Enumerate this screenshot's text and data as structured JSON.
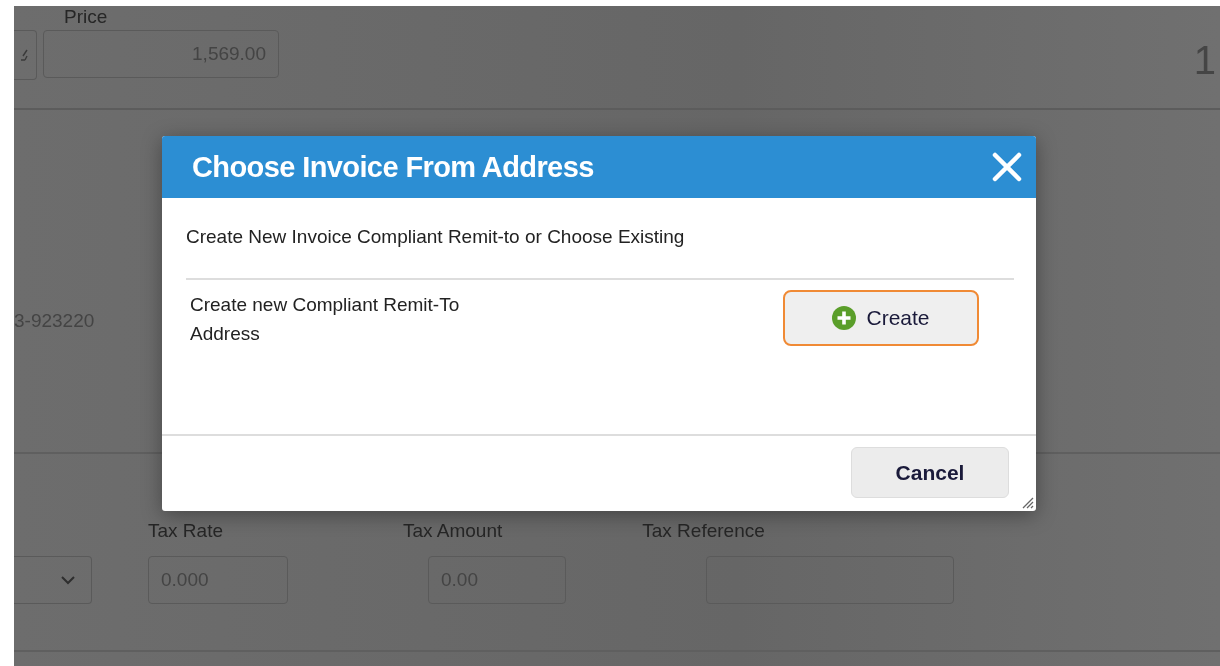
{
  "page": {
    "price_label": "Price",
    "price_value": "1,569.00",
    "row_number": "1",
    "reference_number": "3-923220",
    "tax_rate_label": "Tax Rate",
    "tax_amount_label": "Tax Amount",
    "tax_reference_label": "Tax Reference",
    "tax_rate_value": "0.000",
    "tax_amount_value": "0.00"
  },
  "dialog": {
    "title": "Choose Invoice From Address",
    "intro": "Create New Invoice Compliant Remit-to or Choose Existing",
    "option_label": "Create new Compliant Remit-To Address",
    "create_button": "Create",
    "cancel_button": "Cancel"
  }
}
